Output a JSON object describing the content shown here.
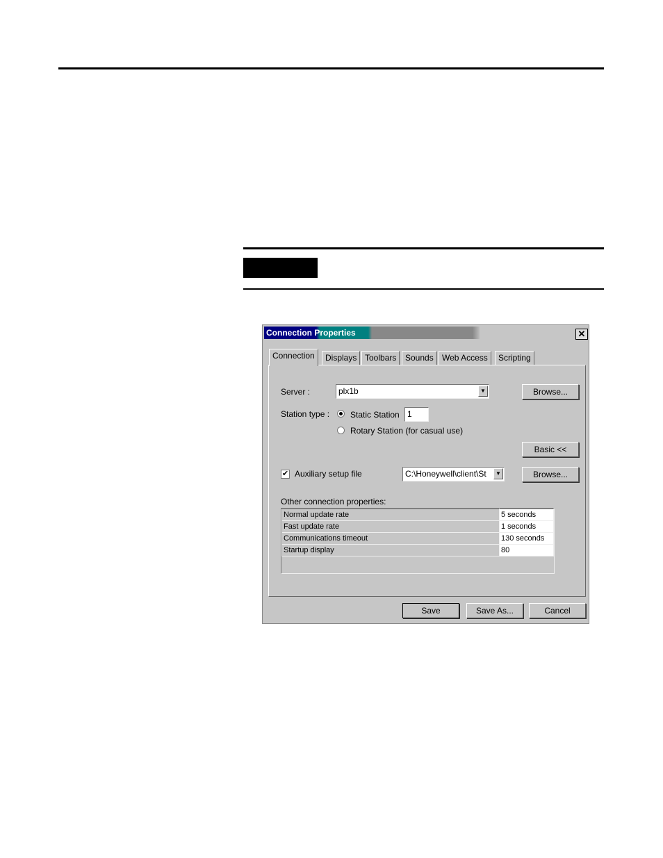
{
  "dialog": {
    "title": "Connection Properties",
    "close_glyph": "✕",
    "tabs": [
      {
        "label": "Connection",
        "active": true
      },
      {
        "label": "Displays"
      },
      {
        "label": "Toolbars"
      },
      {
        "label": "Sounds"
      },
      {
        "label": "Web Access"
      },
      {
        "label": "Scripting"
      }
    ],
    "server_label": "Server :",
    "server_value": "plx1b",
    "browse_label": "Browse...",
    "station_type_label": "Station type :",
    "static_station_label": "Static Station",
    "static_station_value": "1",
    "rotary_station_label": "Rotary Station (for casual use)",
    "station_type_selected": "Static Station",
    "basic_label": "Basic <<",
    "aux_label": "Auxiliary setup file",
    "aux_checked": true,
    "aux_value": "C:\\Honeywell\\client\\St",
    "browse2_label": "Browse...",
    "other_label": "Other connection properties:",
    "properties": [
      {
        "name": "Normal update rate",
        "value": "5  seconds"
      },
      {
        "name": "Fast update rate",
        "value": "1  seconds"
      },
      {
        "name": "Communications timeout",
        "value": "130 seconds"
      },
      {
        "name": "Startup display",
        "value": "80"
      }
    ],
    "save_label": "Save",
    "save_as_label": "Save As...",
    "cancel_label": "Cancel"
  }
}
